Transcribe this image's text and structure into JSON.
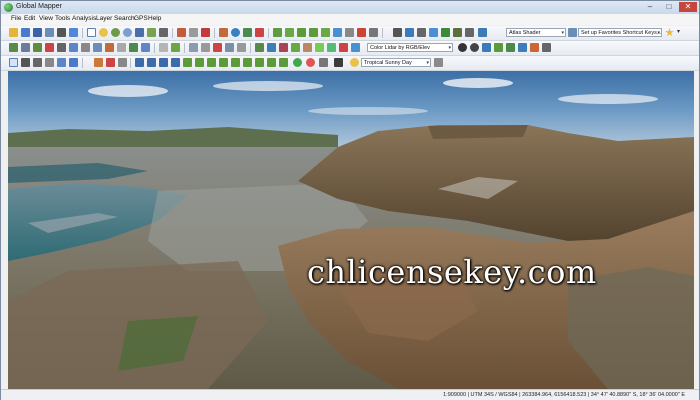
{
  "window": {
    "title": "Global Mapper"
  },
  "window_controls": {
    "minimize": "–",
    "maximize": "□",
    "close": "✕"
  },
  "menu": [
    "File",
    "Edit",
    "View",
    "Tools",
    "Analysis",
    "Layer",
    "Search",
    "GPS",
    "Help"
  ],
  "toolbar1": {
    "shader_combo": "Atlas Shader",
    "shortcut_combo": "Set up Favorites Shortcut Keys..."
  },
  "toolbar2": {
    "lidar_combo": "Color Lidar by RGB/Elev"
  },
  "toolbar3": {
    "sky_combo": "Tropical Sunny Day"
  },
  "overlay": {
    "watermark": "chlicensekey.com"
  },
  "status": {
    "text": "1:909000 | UTM 34S / WGS84 | 263384.964, 6156418.523 | 34° 47' 40.8890\" S, 18° 36' 04.0000\" E"
  },
  "icons": [
    "app-icon",
    "open-icon",
    "save-icon",
    "zoom-in-icon",
    "zoom-out-icon",
    "pan-icon",
    "info-icon",
    "star-icon",
    "play-icon",
    "camera-icon",
    "compass-icon"
  ]
}
